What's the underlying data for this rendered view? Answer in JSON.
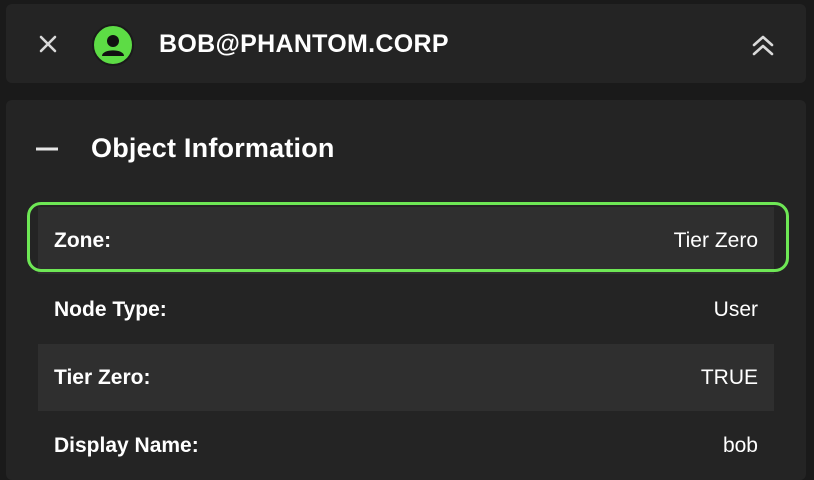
{
  "header": {
    "title": "BOB@PHANTOM.CORP",
    "close_icon": "close-icon",
    "avatar_icon": "user-icon",
    "collapse_icon": "chevrons-up-icon"
  },
  "section": {
    "toggle_icon": "minus-icon",
    "title": "Object Information"
  },
  "rows": [
    {
      "label": "Zone:",
      "value": "Tier Zero",
      "highlighted": true
    },
    {
      "label": "Node Type:",
      "value": "User"
    },
    {
      "label": "Tier Zero:",
      "value": "TRUE"
    },
    {
      "label": "Display Name:",
      "value": "bob"
    }
  ],
  "colors": {
    "background": "#1a1a1a",
    "panel": "#242424",
    "row_shaded": "#2f2f2f",
    "accent": "#6ee755",
    "text": "#ffffff"
  }
}
